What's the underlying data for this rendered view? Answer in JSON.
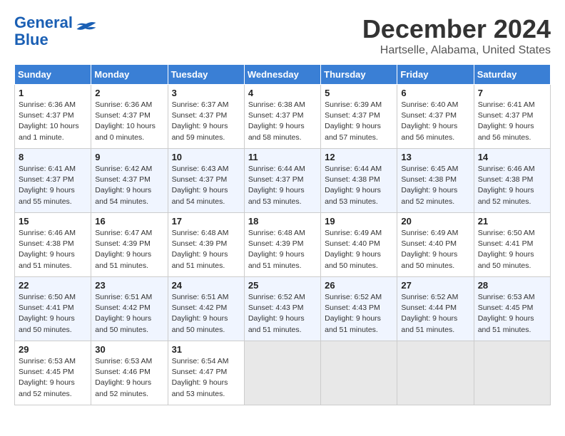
{
  "header": {
    "logo_line1": "General",
    "logo_line2": "Blue",
    "title": "December 2024",
    "subtitle": "Hartselle, Alabama, United States"
  },
  "columns": [
    "Sunday",
    "Monday",
    "Tuesday",
    "Wednesday",
    "Thursday",
    "Friday",
    "Saturday"
  ],
  "weeks": [
    [
      {
        "day": "1",
        "sunrise": "6:36 AM",
        "sunset": "4:37 PM",
        "daylight": "10 hours and 1 minute."
      },
      {
        "day": "2",
        "sunrise": "6:36 AM",
        "sunset": "4:37 PM",
        "daylight": "10 hours and 0 minutes."
      },
      {
        "day": "3",
        "sunrise": "6:37 AM",
        "sunset": "4:37 PM",
        "daylight": "9 hours and 59 minutes."
      },
      {
        "day": "4",
        "sunrise": "6:38 AM",
        "sunset": "4:37 PM",
        "daylight": "9 hours and 58 minutes."
      },
      {
        "day": "5",
        "sunrise": "6:39 AM",
        "sunset": "4:37 PM",
        "daylight": "9 hours and 57 minutes."
      },
      {
        "day": "6",
        "sunrise": "6:40 AM",
        "sunset": "4:37 PM",
        "daylight": "9 hours and 56 minutes."
      },
      {
        "day": "7",
        "sunrise": "6:41 AM",
        "sunset": "4:37 PM",
        "daylight": "9 hours and 56 minutes."
      }
    ],
    [
      {
        "day": "8",
        "sunrise": "6:41 AM",
        "sunset": "4:37 PM",
        "daylight": "9 hours and 55 minutes."
      },
      {
        "day": "9",
        "sunrise": "6:42 AM",
        "sunset": "4:37 PM",
        "daylight": "9 hours and 54 minutes."
      },
      {
        "day": "10",
        "sunrise": "6:43 AM",
        "sunset": "4:37 PM",
        "daylight": "9 hours and 54 minutes."
      },
      {
        "day": "11",
        "sunrise": "6:44 AM",
        "sunset": "4:37 PM",
        "daylight": "9 hours and 53 minutes."
      },
      {
        "day": "12",
        "sunrise": "6:44 AM",
        "sunset": "4:38 PM",
        "daylight": "9 hours and 53 minutes."
      },
      {
        "day": "13",
        "sunrise": "6:45 AM",
        "sunset": "4:38 PM",
        "daylight": "9 hours and 52 minutes."
      },
      {
        "day": "14",
        "sunrise": "6:46 AM",
        "sunset": "4:38 PM",
        "daylight": "9 hours and 52 minutes."
      }
    ],
    [
      {
        "day": "15",
        "sunrise": "6:46 AM",
        "sunset": "4:38 PM",
        "daylight": "9 hours and 51 minutes."
      },
      {
        "day": "16",
        "sunrise": "6:47 AM",
        "sunset": "4:39 PM",
        "daylight": "9 hours and 51 minutes."
      },
      {
        "day": "17",
        "sunrise": "6:48 AM",
        "sunset": "4:39 PM",
        "daylight": "9 hours and 51 minutes."
      },
      {
        "day": "18",
        "sunrise": "6:48 AM",
        "sunset": "4:39 PM",
        "daylight": "9 hours and 51 minutes."
      },
      {
        "day": "19",
        "sunrise": "6:49 AM",
        "sunset": "4:40 PM",
        "daylight": "9 hours and 50 minutes."
      },
      {
        "day": "20",
        "sunrise": "6:49 AM",
        "sunset": "4:40 PM",
        "daylight": "9 hours and 50 minutes."
      },
      {
        "day": "21",
        "sunrise": "6:50 AM",
        "sunset": "4:41 PM",
        "daylight": "9 hours and 50 minutes."
      }
    ],
    [
      {
        "day": "22",
        "sunrise": "6:50 AM",
        "sunset": "4:41 PM",
        "daylight": "9 hours and 50 minutes."
      },
      {
        "day": "23",
        "sunrise": "6:51 AM",
        "sunset": "4:42 PM",
        "daylight": "9 hours and 50 minutes."
      },
      {
        "day": "24",
        "sunrise": "6:51 AM",
        "sunset": "4:42 PM",
        "daylight": "9 hours and 50 minutes."
      },
      {
        "day": "25",
        "sunrise": "6:52 AM",
        "sunset": "4:43 PM",
        "daylight": "9 hours and 51 minutes."
      },
      {
        "day": "26",
        "sunrise": "6:52 AM",
        "sunset": "4:43 PM",
        "daylight": "9 hours and 51 minutes."
      },
      {
        "day": "27",
        "sunrise": "6:52 AM",
        "sunset": "4:44 PM",
        "daylight": "9 hours and 51 minutes."
      },
      {
        "day": "28",
        "sunrise": "6:53 AM",
        "sunset": "4:45 PM",
        "daylight": "9 hours and 51 minutes."
      }
    ],
    [
      {
        "day": "29",
        "sunrise": "6:53 AM",
        "sunset": "4:45 PM",
        "daylight": "9 hours and 52 minutes."
      },
      {
        "day": "30",
        "sunrise": "6:53 AM",
        "sunset": "4:46 PM",
        "daylight": "9 hours and 52 minutes."
      },
      {
        "day": "31",
        "sunrise": "6:54 AM",
        "sunset": "4:47 PM",
        "daylight": "9 hours and 53 minutes."
      },
      null,
      null,
      null,
      null
    ]
  ]
}
